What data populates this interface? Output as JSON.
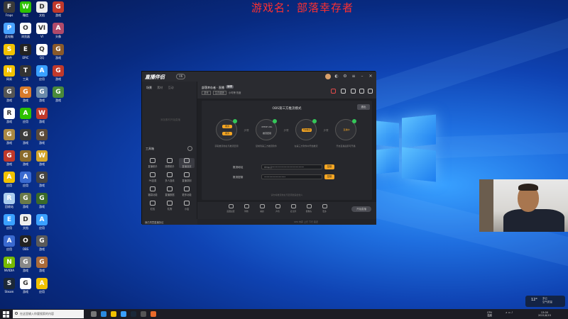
{
  "banner": "游戏名：部落幸存者",
  "desktop_icons": [
    {
      "label": "Fraps",
      "color": "#3a3a3a",
      "glyph": "F"
    },
    {
      "label": "微信",
      "color": "#2dc100",
      "glyph": "W"
    },
    {
      "label": "文档",
      "color": "#eeeeee",
      "glyph": "D"
    },
    {
      "label": "游戏",
      "color": "#c0392b",
      "glyph": "G"
    },
    {
      "label": "此电脑",
      "color": "#4aa3ff",
      "glyph": "P"
    },
    {
      "label": "浏览器",
      "color": "#ffffff",
      "glyph": "O"
    },
    {
      "label": "VI",
      "color": "#ffffff",
      "glyph": "VI"
    },
    {
      "label": "头像",
      "color": "#b04a6a",
      "glyph": "A"
    },
    {
      "label": "软件",
      "color": "#f2c200",
      "glyph": "S"
    },
    {
      "label": "EPIC",
      "color": "#222222",
      "glyph": "E"
    },
    {
      "label": "QQ",
      "color": "#ffffff",
      "glyph": "Q"
    },
    {
      "label": "游戏",
      "color": "#8a5a2a",
      "glyph": "G"
    },
    {
      "label": "网易",
      "color": "#f2c200",
      "glyph": "N"
    },
    {
      "label": "工具",
      "color": "#333333",
      "glyph": "T"
    },
    {
      "label": "应用",
      "color": "#3aa0ff",
      "glyph": "A"
    },
    {
      "label": "游戏",
      "color": "#c0392b",
      "glyph": "G"
    },
    {
      "label": "游戏",
      "color": "#555555",
      "glyph": "G"
    },
    {
      "label": "游戏",
      "color": "#d87a2a",
      "glyph": "G"
    },
    {
      "label": "游戏",
      "color": "#6a8aaa",
      "glyph": "G"
    },
    {
      "label": "游戏",
      "color": "#4a8a3a",
      "glyph": "G"
    },
    {
      "label": "游戏",
      "color": "#ffffff",
      "glyph": "R"
    },
    {
      "label": "应用",
      "color": "#2dc100",
      "glyph": "A"
    },
    {
      "label": "游戏",
      "color": "#c0392b",
      "glyph": "W"
    },
    {
      "label": "",
      "color": "#00000000",
      "glyph": ""
    },
    {
      "label": "游戏",
      "color": "#aa8844",
      "glyph": "G"
    },
    {
      "label": "游戏",
      "color": "#3a3a3a",
      "glyph": "G"
    },
    {
      "label": "游戏",
      "color": "#5a4a3a",
      "glyph": "G"
    },
    {
      "label": "",
      "color": "#00000000",
      "glyph": ""
    },
    {
      "label": "游戏",
      "color": "#c0392b",
      "glyph": "G"
    },
    {
      "label": "游戏",
      "color": "#8a6a2a",
      "glyph": "G"
    },
    {
      "label": "游戏",
      "color": "#d4a62a",
      "glyph": "W"
    },
    {
      "label": "",
      "color": "#00000000",
      "glyph": ""
    },
    {
      "label": "应用",
      "color": "#f2c200",
      "glyph": "A"
    },
    {
      "label": "应用",
      "color": "#3a6ad0",
      "glyph": "A"
    },
    {
      "label": "游戏",
      "color": "#444444",
      "glyph": "G"
    },
    {
      "label": "",
      "color": "#00000000",
      "glyph": ""
    },
    {
      "label": "回收站",
      "color": "#aaccee",
      "glyph": "R"
    },
    {
      "label": "游戏",
      "color": "#6a7a4a",
      "glyph": "G"
    },
    {
      "label": "游戏",
      "color": "#3a6a2a",
      "glyph": "G"
    },
    {
      "label": "",
      "color": "#00000000",
      "glyph": ""
    },
    {
      "label": "应用",
      "color": "#3aa0ff",
      "glyph": "E"
    },
    {
      "label": "文档",
      "color": "#eeeeee",
      "glyph": "D"
    },
    {
      "label": "应用",
      "color": "#3aa0ff",
      "glyph": "A"
    },
    {
      "label": "",
      "color": "#00000000",
      "glyph": ""
    },
    {
      "label": "应用",
      "color": "#3a6ad0",
      "glyph": "A"
    },
    {
      "label": "OBS",
      "color": "#222222",
      "glyph": "O"
    },
    {
      "label": "游戏",
      "color": "#5a5a5a",
      "glyph": "G"
    },
    {
      "label": "",
      "color": "#00000000",
      "glyph": ""
    },
    {
      "label": "NVIDIA",
      "color": "#76b900",
      "glyph": "N"
    },
    {
      "label": "游戏",
      "color": "#888888",
      "glyph": "G"
    },
    {
      "label": "游戏",
      "color": "#aa6a3a",
      "glyph": "G"
    },
    {
      "label": "",
      "color": "#00000000",
      "glyph": ""
    },
    {
      "label": "Steam",
      "color": "#1b2838",
      "glyph": "S"
    },
    {
      "label": "游戏",
      "color": "#ffffff",
      "glyph": "G"
    },
    {
      "label": "应用",
      "color": "#f2c200",
      "glyph": "A"
    }
  ],
  "app": {
    "logo": "直播伴侣",
    "version": "V6",
    "sidebar": {
      "tabs": [
        "场景",
        "素材",
        "互动"
      ],
      "empty_text": "添加素材开始直播",
      "tools_title": "工具箱",
      "tools": [
        {
          "label": "直播助手"
        },
        {
          "label": "观看助手"
        },
        {
          "label": "直播回放"
        },
        {
          "label": "PK连麦"
        },
        {
          "label": "多人连线"
        },
        {
          "label": "直播录制"
        },
        {
          "label": "福袋功能"
        },
        {
          "label": "直播数据"
        },
        {
          "label": "更多功能"
        },
        {
          "label": "红包"
        },
        {
          "label": "礼物"
        },
        {
          "label": "小店"
        }
      ],
      "footer": "我已同意直播协议"
    },
    "header": {
      "room_title": "部落幸存者 · 直播",
      "edit_label": "编辑",
      "tags": [
        "游戏",
        "生存建造",
        "小时榜",
        "热度"
      ]
    },
    "stage": {
      "mode_title": "OBS第三方推流模式",
      "exit_label": "退出",
      "steps": [
        {
          "top": "推流",
          "bottom": "推流",
          "desc": "获取推流地址与推流密钥"
        },
        {
          "top": "RTMP URL",
          "bottom": "推流密钥",
          "desc": "复制到第三方推流软件"
        },
        {
          "top": "开始推流",
          "bottom": "",
          "desc": "在第三方软件中开始推流"
        },
        {
          "top": "直播中",
          "bottom": "",
          "desc": "开启直播后即可开播"
        }
      ],
      "arrows": [
        "步骤",
        "步骤",
        "步骤"
      ],
      "fields": [
        {
          "label": "推流地址",
          "value": "rtmp://••••••••••••••••••••••••",
          "button": "复制"
        },
        {
          "label": "推流密钥",
          "value": "••••••••••••••••",
          "button": "复制"
        }
      ],
      "hint": "请勿将推流地址与密钥透露给他人"
    },
    "bottom_tools": [
      {
        "label": "画面设置"
      },
      {
        "label": "特效"
      },
      {
        "label": "美颜"
      },
      {
        "label": "声音"
      },
      {
        "label": "麦克风"
      },
      {
        "label": "摄像头"
      },
      {
        "label": "更多"
      }
    ],
    "go_live_label": "开始直播",
    "status": "CPU  内存  上行  下行  延迟"
  },
  "widget": {
    "temp": "12°",
    "line1": "多云",
    "line2": "空气质量"
  },
  "taskbar": {
    "search_placeholder": "在这里输入你要搜索的内容",
    "apps": [
      {
        "name": "task-view",
        "color": "#777777"
      },
      {
        "name": "edge",
        "color": "#2a8adf"
      },
      {
        "name": "explorer",
        "color": "#f2c200"
      },
      {
        "name": "store",
        "color": "#3aa0ff"
      },
      {
        "name": "steam",
        "color": "#1b2838"
      },
      {
        "name": "app",
        "color": "#555555"
      },
      {
        "name": "live-companion",
        "color": "#e86a2a"
      }
    ],
    "tray_line1": "CPU",
    "tray_line2": "温度",
    "clock_time": "13:00",
    "clock_date": "2021/8/15"
  }
}
